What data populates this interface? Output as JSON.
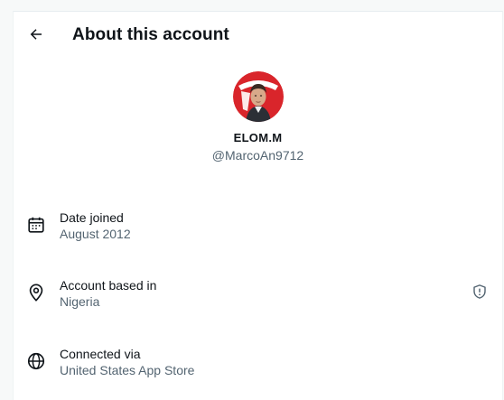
{
  "header": {
    "title": "About this account",
    "back_icon": "arrow-left-icon"
  },
  "profile": {
    "display_name": "ELOM.M",
    "handle": "@MarcoAn9712",
    "avatar_icon": "profile-photo"
  },
  "details": [
    {
      "icon": "calendar-icon",
      "label": "Date joined",
      "value": "August 2012"
    },
    {
      "icon": "location-pin-icon",
      "label": "Account based in",
      "value": "Nigeria",
      "badge_icon": "shield-icon"
    },
    {
      "icon": "globe-icon",
      "label": "Connected via",
      "value": "United States App Store"
    }
  ],
  "colors": {
    "text_primary": "#0f1419",
    "text_secondary": "#536471",
    "avatar_red": "#d9252b"
  }
}
